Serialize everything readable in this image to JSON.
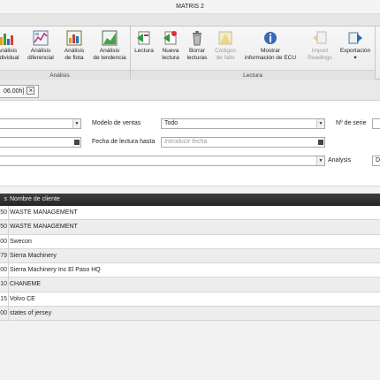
{
  "window": {
    "title": "MATRIS 2"
  },
  "ribbon": {
    "groups": [
      {
        "label": "Análisis"
      },
      {
        "label": "Lectura"
      }
    ],
    "buttons": [
      {
        "label": "Análisis\nindividual",
        "icon": "bar-chart-icon",
        "enabled": true
      },
      {
        "label": "Análisis\ndiferencial",
        "icon": "image-chart-icon",
        "enabled": true
      },
      {
        "label": "Análisis\nde flota",
        "icon": "fleet-chart-icon",
        "enabled": true
      },
      {
        "label": "Análisis\nde tendencia",
        "icon": "trend-chart-icon",
        "enabled": true
      },
      {
        "label": "Lectura",
        "icon": "read-icon",
        "enabled": true
      },
      {
        "label": "Nueva\nlectura",
        "icon": "new-read-icon",
        "enabled": true
      },
      {
        "label": "Borrar\nlecturas",
        "icon": "trash-icon",
        "enabled": true
      },
      {
        "label": "Códigos\nde fallo",
        "icon": "warning-icon",
        "enabled": false
      },
      {
        "label": "Mostrar\ninformación de ECU",
        "icon": "ecu-info-icon",
        "enabled": true
      },
      {
        "label": "Import\nReadings",
        "icon": "import-icon",
        "enabled": false
      },
      {
        "label": "Exportación\n▾",
        "icon": "export-icon",
        "enabled": true
      }
    ]
  },
  "doc_tab": {
    "label": "06.00h]",
    "close": "×"
  },
  "filters": {
    "modelo_label": "Modelo de ventas",
    "modelo_value": "Todo",
    "serie_label": "Nº de serie",
    "fecha_label": "Fecha de lectura hasta",
    "fecha_placeholder": "Introducir fecha",
    "analysis_label": "Analysis",
    "analysis_value": "D"
  },
  "grid": {
    "col1_header": "s",
    "col2_header": "Nombre de cliente",
    "rows": [
      {
        "c1": "50",
        "name": "WASTE MANAGEMENT"
      },
      {
        "c1": "50",
        "name": "WASTE MANAGEMENT"
      },
      {
        "c1": "00",
        "name": "Swecon"
      },
      {
        "c1": "79",
        "name": "Sierra Machinery"
      },
      {
        "c1": "00",
        "name": "Sierra Machinery Inc El Paso HQ"
      },
      {
        "c1": "10",
        "name": "CHANEME"
      },
      {
        "c1": "15",
        "name": "Volvo CE"
      },
      {
        "c1": "00",
        "name": "states of jersey"
      }
    ]
  },
  "colors": {
    "grid_header": "#2e2e2e",
    "row_alt": "#ededed",
    "ribbon_bg": "#f2f2f2"
  }
}
